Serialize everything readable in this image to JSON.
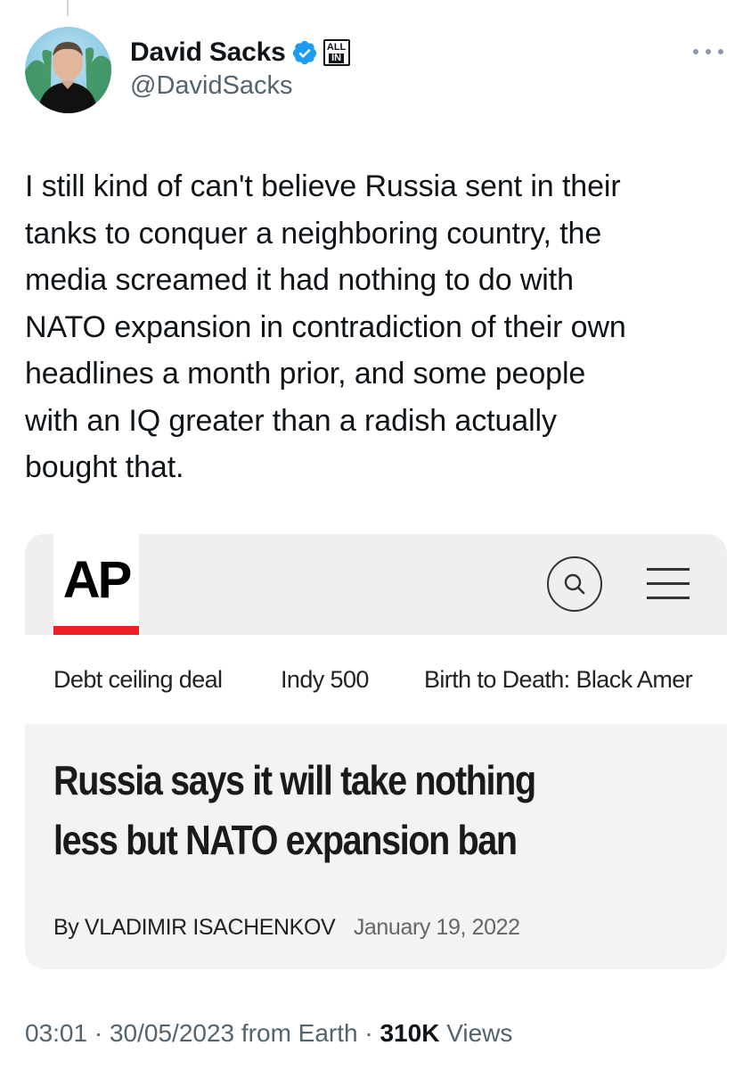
{
  "author": {
    "display_name": "David Sacks",
    "handle": "@DavidSacks",
    "verified_color": "#1d9bf0",
    "affiliate_badge": {
      "line1": "ALL",
      "line2": "IN"
    }
  },
  "tweet": {
    "text": "I still kind of can't believe Russia sent in their\ntanks to conquer a neighboring country, the\nmedia screamed it had nothing to do with\nNATO expansion in contradiction of their own\nheadlines a month prior, and some people\nwith an IQ greater than a radish actually\nbought that."
  },
  "embedded_card": {
    "logo_text": "AP",
    "logo_accent_color": "#ed2024",
    "nav_items": [
      "Debt ceiling deal",
      "Indy 500",
      "Birth to Death: Black Amer"
    ],
    "headline": "Russia says it will take nothing\nless but NATO expansion ban",
    "byline": "By VLADIMIR ISACHENKOV",
    "date": "January 19, 2022",
    "icons": [
      "search-icon",
      "hamburger-menu-icon"
    ]
  },
  "meta": {
    "time": "03:01",
    "date": "30/05/2023",
    "source": "from Earth",
    "views_count": "310K",
    "views_label": "Views"
  },
  "icons": [
    "more-options-icon",
    "verified-badge-icon",
    "affiliate-badge-icon"
  ]
}
